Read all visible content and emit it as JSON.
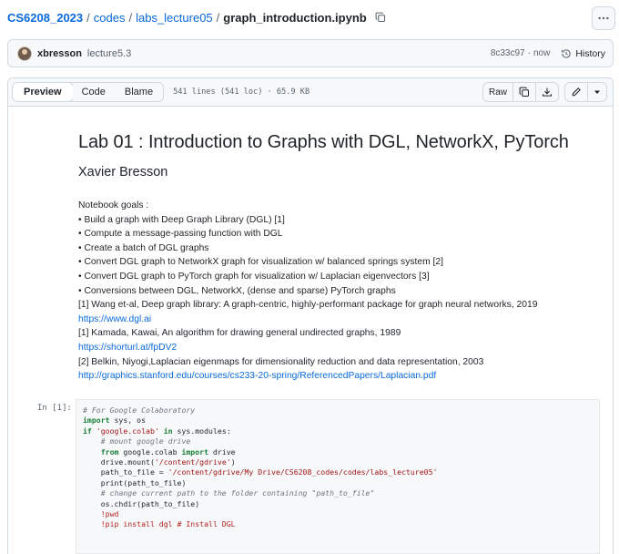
{
  "breadcrumb": {
    "repo": "CS6208_2023",
    "sep": "/",
    "dir1": "codes",
    "dir2": "labs_lecture05",
    "file": "graph_introduction.ipynb"
  },
  "commit": {
    "author": "xbresson",
    "message": "lecture5.3",
    "sha": "8c33c97",
    "dot": "·",
    "time": "now",
    "history_label": "History"
  },
  "file_header": {
    "tabs": [
      "Preview",
      "Code",
      "Blame"
    ],
    "active_tab": "Preview",
    "meta": "541 lines (541 loc) · 65.9 KB",
    "raw_label": "Raw"
  },
  "notebook": {
    "title": "Lab 01 : Introduction to Graphs with DGL, NetworkX, PyTorch",
    "author": "Xavier Bresson",
    "lines": [
      {
        "text": "Notebook goals :"
      },
      {
        "text": "• Build a graph with Deep Graph Library (DGL) [1]"
      },
      {
        "text": "• Compute a message-passing function with DGL"
      },
      {
        "text": "• Create a batch of DGL graphs"
      },
      {
        "text": "• Convert DGL graph to NetworkX graph for visualization w/ balanced springs system [2]"
      },
      {
        "text": "• Convert DGL graph to PyTorch graph for visualization w/ Laplacian eigenvectors [3]"
      },
      {
        "text": "• Conversions between DGL, NetworkX, (dense and sparse) PyTorch graphs"
      },
      {
        "text": "[1] Wang et-al, Deep graph library: A graph-centric, highly-performant package for graph neural networks, 2019"
      },
      {
        "link": "https://www.dgl.ai"
      },
      {
        "text": "[1] Kamada, Kawai, An algorithm for drawing general undirected graphs, 1989"
      },
      {
        "link": "https://shorturl.at/fpDV2"
      },
      {
        "text": "[2] Belkin, Niyogi,Laplacian eigenmaps for dimensionality reduction and data representation, 2003"
      },
      {
        "link": "http://graphics.stanford.edu/courses/cs233-20-spring/ReferencedPapers/Laplacian.pdf"
      }
    ],
    "cell_prompt": "In [1]:",
    "code_lines": [
      [
        {
          "t": "# For Google Colaboratory",
          "c": "c"
        }
      ],
      [
        {
          "t": "import",
          "c": "k"
        },
        {
          "t": " sys, os"
        }
      ],
      [
        {
          "t": "if",
          "c": "k"
        },
        {
          "t": " "
        },
        {
          "t": "'google.colab'",
          "c": "s"
        },
        {
          "t": " "
        },
        {
          "t": "in",
          "c": "k"
        },
        {
          "t": " sys.modules:"
        }
      ],
      [
        {
          "t": "    "
        },
        {
          "t": "# mount google drive",
          "c": "c"
        }
      ],
      [
        {
          "t": "    "
        },
        {
          "t": "from",
          "c": "k"
        },
        {
          "t": " google.colab "
        },
        {
          "t": "import",
          "c": "k"
        },
        {
          "t": " drive"
        }
      ],
      [
        {
          "t": "    drive.mount("
        },
        {
          "t": "'/content/gdrive'",
          "c": "s"
        },
        {
          "t": ")"
        }
      ],
      [
        {
          "t": "    path_to_file = "
        },
        {
          "t": "'/content/gdrive/My Drive/CS6208_codes/codes/labs_lecture05'",
          "c": "s"
        }
      ],
      [
        {
          "t": "    print(path_to_file)"
        }
      ],
      [
        {
          "t": "    "
        },
        {
          "t": "# change current path to the folder containing \"path_to_file\"",
          "c": "c"
        }
      ],
      [
        {
          "t": "    os.chdir(path_to_file)"
        }
      ],
      [
        {
          "t": "    "
        },
        {
          "t": "!pwd",
          "c": "b"
        }
      ],
      [
        {
          "t": "    "
        },
        {
          "t": "!pip install dgl # Install DGL",
          "c": "b"
        }
      ]
    ]
  }
}
